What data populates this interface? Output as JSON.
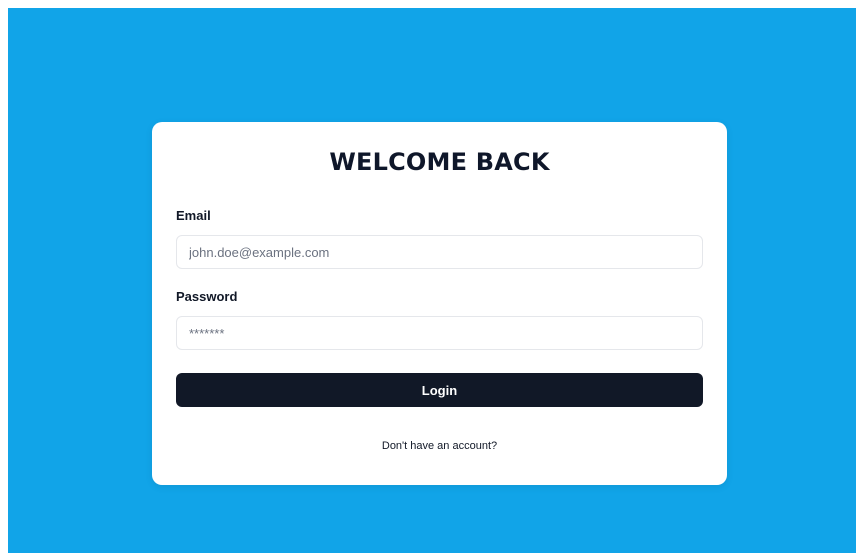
{
  "login_card": {
    "title": "WELCOME BACK",
    "email": {
      "label": "Email",
      "placeholder": "john.doe@example.com",
      "value": ""
    },
    "password": {
      "label": "Password",
      "placeholder": "*******",
      "value": ""
    },
    "submit_label": "Login",
    "signup_prompt": "Don't have an account?"
  },
  "colors": {
    "background": "#11a4e8",
    "card": "#ffffff",
    "button": "#111827",
    "button_text": "#ffffff",
    "heading": "#0f172a"
  }
}
